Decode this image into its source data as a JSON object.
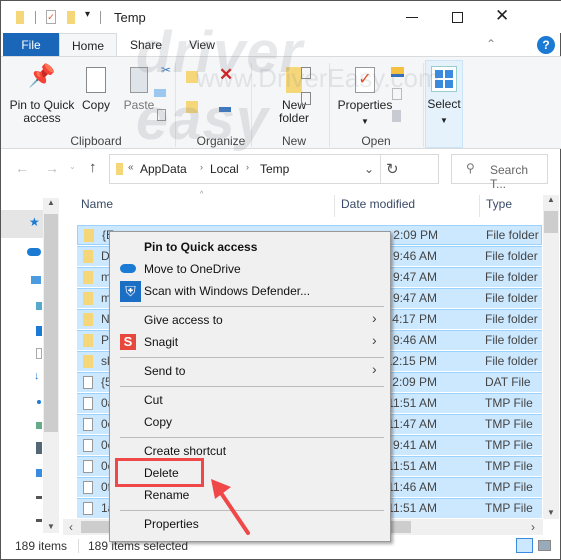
{
  "window": {
    "title": "Temp",
    "minimize_icon": "minimize-icon",
    "maximize_icon": "maximize-icon",
    "close_icon": "close-icon"
  },
  "watermark": {
    "logo": "driver easy",
    "url": "www.DriverEasy.com"
  },
  "ribbon_tabs": [
    {
      "label": "File"
    },
    {
      "label": "Home"
    },
    {
      "label": "Share"
    },
    {
      "label": "View"
    }
  ],
  "ribbon": {
    "clipboard": {
      "label": "Clipboard",
      "pin": "Pin to Quick access",
      "copy": "Copy",
      "paste": "Paste"
    },
    "organize": {
      "label": "Organize"
    },
    "new": {
      "label": "New",
      "new_folder": "New folder"
    },
    "open": {
      "label": "Open",
      "properties": "Properties"
    },
    "select": {
      "label": "Select"
    }
  },
  "address": {
    "path": [
      "AppData",
      "Local",
      "Temp"
    ],
    "search_placeholder": "Search T..."
  },
  "columns": {
    "name": "Name",
    "date": "Date modified",
    "type": "Type"
  },
  "rows": [
    {
      "name": "{E",
      "date": "2:09 PM",
      "type": "File folder",
      "kind": "folder"
    },
    {
      "name": "D",
      "date": "9:46 AM",
      "type": "File folder",
      "kind": "folder"
    },
    {
      "name": "m",
      "date": "9:47 AM",
      "type": "File folder",
      "kind": "folder"
    },
    {
      "name": "m",
      "date": "9:47 AM",
      "type": "File folder",
      "kind": "folder"
    },
    {
      "name": "N",
      "date": "4:17 PM",
      "type": "File folder",
      "kind": "folder"
    },
    {
      "name": "P",
      "date": "9:46 AM",
      "type": "File folder",
      "kind": "folder"
    },
    {
      "name": "sk",
      "date": "12:15 PM",
      "type": "File folder",
      "kind": "folder"
    },
    {
      "name": "{5",
      "date": "2:09 PM",
      "type": "DAT File",
      "kind": "file"
    },
    {
      "name": "0a",
      "date": "11:51 AM",
      "type": "TMP File",
      "kind": "file"
    },
    {
      "name": "0e",
      "date": "11:47 AM",
      "type": "TMP File",
      "kind": "file"
    },
    {
      "name": "0e",
      "date": "9:41 AM",
      "type": "TMP File",
      "kind": "file"
    },
    {
      "name": "0e",
      "date": "11:51 AM",
      "type": "TMP File",
      "kind": "file"
    },
    {
      "name": "0f",
      "date": "11:46 AM",
      "type": "TMP File",
      "kind": "file"
    },
    {
      "name": "1a",
      "date": "11:51 AM",
      "type": "TMP File",
      "kind": "file"
    }
  ],
  "context_menu": {
    "items": [
      "Pin to Quick access",
      "Move to OneDrive",
      "Scan with Windows Defender...",
      "Give access to",
      "Snagit",
      "Send to",
      "Cut",
      "Copy",
      "Create shortcut",
      "Delete",
      "Rename",
      "Properties"
    ]
  },
  "status": {
    "count": "189 items",
    "selected": "189 items selected"
  },
  "colors": {
    "accent": "#0063b1",
    "selection": "#cce8ff",
    "highlight": "#f04848"
  }
}
